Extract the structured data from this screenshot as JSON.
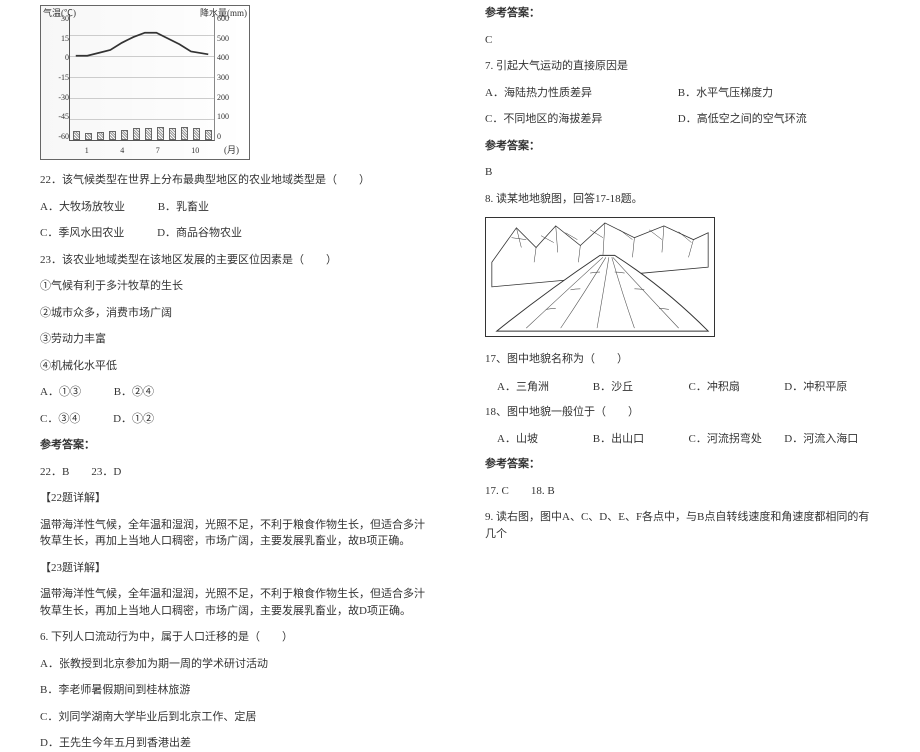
{
  "chart_data": {
    "type": "combo",
    "left_axis": {
      "label": "气温(℃)",
      "ticks": [
        "30",
        "15",
        "0",
        "-15",
        "-30",
        "-45",
        "-60"
      ]
    },
    "right_axis": {
      "label": "降水量(mm)",
      "ticks": [
        "600",
        "500",
        "400",
        "300",
        "200",
        "100",
        "0"
      ]
    },
    "x_axis": {
      "label": "(月)",
      "ticks": [
        "1",
        "4",
        "7",
        "10"
      ]
    },
    "temperature": [
      4,
      4,
      6,
      8,
      12,
      16,
      18,
      18,
      15,
      11,
      7,
      5
    ],
    "precipitation": [
      45,
      35,
      40,
      45,
      50,
      55,
      55,
      60,
      55,
      60,
      55,
      50
    ]
  },
  "left": {
    "q22": "22．该气候类型在世界上分布最典型地区的农业地域类型是（　　）",
    "q22_a": "A．大牧场放牧业",
    "q22_b": "B．乳畜业",
    "q22_c": "C．季风水田农业",
    "q22_d": "D．商品谷物农业",
    "q23": "23．该农业地域类型在该地区发展的主要区位因素是（　　）",
    "q23_1": "①气候有利于多汁牧草的生长",
    "q23_2": "②城市众多，消费市场广阔",
    "q23_3": "③劳动力丰富",
    "q23_4": "④机械化水平低",
    "q23_a": "A．①③",
    "q23_b": "B．②④",
    "q23_c": "C．③④",
    "q23_d": "D．①②",
    "ans_label": "参考答案：",
    "ans_text": "22．B　　23．D",
    "exp22_h": "【22题详解】",
    "exp22": "温带海洋性气候，全年温和湿润，光照不足，不利于粮食作物生长，但适合多汁牧草生长，再加上当地人口稠密，市场广阔，主要发展乳畜业，故B项正确。",
    "exp23_h": "【23题详解】",
    "exp23": "温带海洋性气候，全年温和湿润，光照不足，不利于粮食作物生长，但适合多汁牧草生长，再加上当地人口稠密，市场广阔，主要发展乳畜业，故D项正确。",
    "q6": "6. 下列人口流动行为中，属于人口迁移的是（　　）",
    "q6_a": "A．张教授到北京参加为期一周的学术研讨活动",
    "q6_b": "B．李老师暑假期间到桂林旅游",
    "q6_c": "C．刘同学湖南大学毕业后到北京工作、定居",
    "q6_d": "D．王先生今年五月到香港出差"
  },
  "right": {
    "ans_label": "参考答案：",
    "ans6": "C",
    "q7": "7. 引起大气运动的直接原因是",
    "q7_a": "A．海陆热力性质差异",
    "q7_b": "B．水平气压梯度力",
    "q7_c": "C．不同地区的海拔差异",
    "q7_d": "D．高低空之间的空气环流",
    "ans7": "B",
    "q8": "8. 读某地地貌图，回答17-18题。",
    "q17": "17、图中地貌名称为（　　）",
    "q17_a": "A．三角洲",
    "q17_b": "B．沙丘",
    "q17_c": "C．冲积扇",
    "q17_d": "D．冲积平原",
    "q18": "18、图中地貌一般位于（　　）",
    "q18_a": "A．山坡",
    "q18_b": "B．出山口",
    "q18_c": "C．河流拐弯处",
    "q18_d": "D．河流入海口",
    "ans1718": "17. C　　18. B",
    "q9": "9. 读右图，图中A、C、D、E、F各点中，与B点自转线速度和角速度都相同的有几个"
  }
}
